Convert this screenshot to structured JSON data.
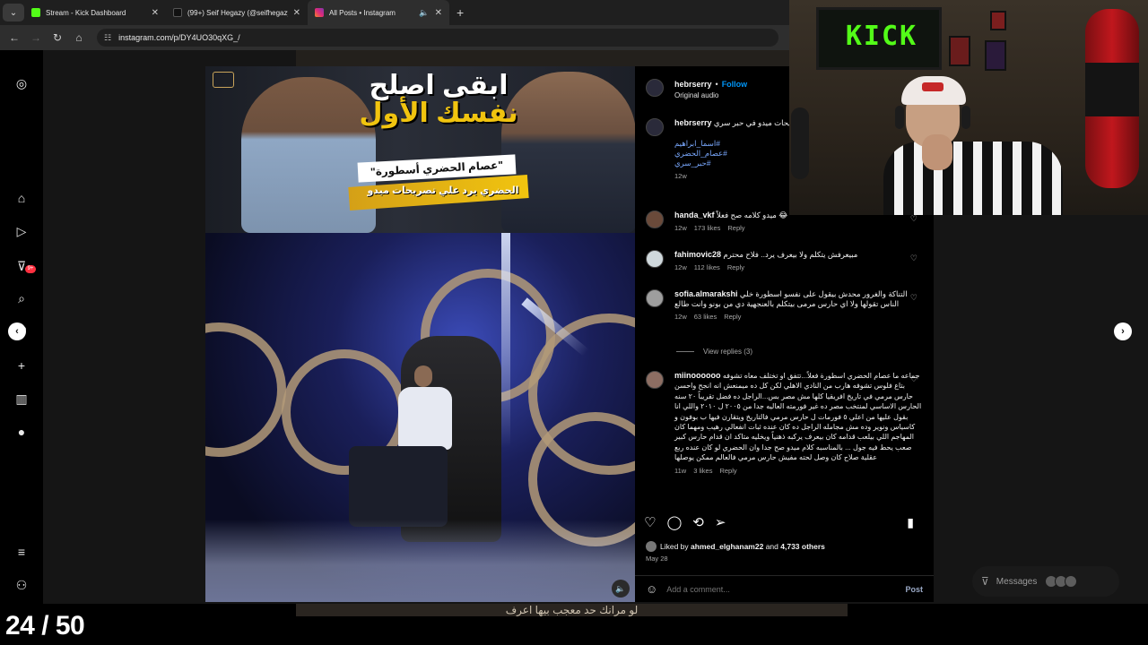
{
  "browser": {
    "tabs": [
      {
        "label": "Stream - Kick Dashboard",
        "color": "#53fc18"
      },
      {
        "label": "(99+) Seif Hegazy (@seifhegazy",
        "color": "#111111"
      },
      {
        "label": "All Posts • Instagram",
        "color": "#e1306c"
      }
    ],
    "url": "instagram.com/p/DY4UO30qXG_/"
  },
  "post": {
    "thumbnail": {
      "title_line1": "ابقى اصلح",
      "title_line2": "نفسك الأول",
      "subtitle": "\"عصام الحضري أسطورة\"",
      "caption": "الحضري يرد علي تصريحات ميدو"
    },
    "header": {
      "username": "hebrserry",
      "separator": "•",
      "follow": "Follow",
      "audio": "Original audio"
    },
    "caption": {
      "username": "hebrserry",
      "text": "الحضري أسطورة\" الحضري يرد علي تصريحات ميدو في حبر سري",
      "hashtags": [
        "#اسما_ابراهيم",
        "#عصام_الحضري",
        "#حبر_سري"
      ],
      "time": "12w"
    },
    "comments": [
      {
        "username": "handa_vkf",
        "text": "ميدو كلامه صح فعلاً 😂",
        "time": "12w",
        "likes": "173 likes",
        "reply": "Reply"
      },
      {
        "username": "fahimovic28",
        "text": "مبيعرفش يتكلم ولا بيعرف يرد.. فلاح محترم",
        "time": "12w",
        "likes": "112 likes",
        "reply": "Reply"
      },
      {
        "username": "sofia.almarakshi",
        "text": "التناكة والغرور محدش بيقول على نفسو اسطورة خلي الناس تقولها ولا اي حارس مرمى بيتكلم بالعنجهية دي من بونو وانت طالع",
        "time": "12w",
        "likes": "63 likes",
        "reply": "Reply",
        "view_replies": "View replies (3)"
      },
      {
        "username": "miinoooooo",
        "text": "جماعه ما عصام الحضري اسطورة فعلاً...تتفق او تختلف معاه تشوفه بتاع فلوس تشوفه هارب من النادي الاهلي لكن كل ده ميمنعش انه انجح واحسن حارس مرمي في تاريخ افريقيا كلها مش مصر بس...الراجل ده فضل تقريباً ٢٠ سنه الحارس الاساسي لمنتخب مصر ده غير فورمته العاليه جدا من ٢٠٠٥ ل ٢٠١٠ واللي انا بقول عليها من اعلي ٥ فورمات ل حارس مرمي فالتاريخ ويتقارن فيها ب بوفون و كاسياس ونوير وده مش مجامله الراجل ده كان عنده ثبات انفعالي رهيب ومهما كان المهاجم اللي بيلعب قدامه كان بيعرف يركبه ذهنياً ويخليه متاكد ان قدام حارس كبير صعب يحط فيه جول ... بالمناسبه كلام ميدو صح جدا وان الحضري لو كان عنده ربع عقلية صلاح كان وصل لحته مفيش حارس مرمي فالعالم ممكن يوصلها",
        "time": "11w",
        "likes": "3 likes",
        "reply": "Reply"
      }
    ],
    "liked_by_prefix": "Liked by",
    "liked_by_user": "ahmed_elghanam22",
    "liked_by_suffix": "and",
    "liked_by_count": "4,733 others",
    "date": "May 28",
    "add_comment_placeholder": "Add a comment...",
    "post_button": "Post"
  },
  "messages": {
    "label": "Messages"
  },
  "webcam": {
    "sign": "KICK"
  },
  "counter": {
    "text": "24 / 50"
  },
  "bottom_subtitle": "لو مرانك حد معجب بيها اعرف"
}
